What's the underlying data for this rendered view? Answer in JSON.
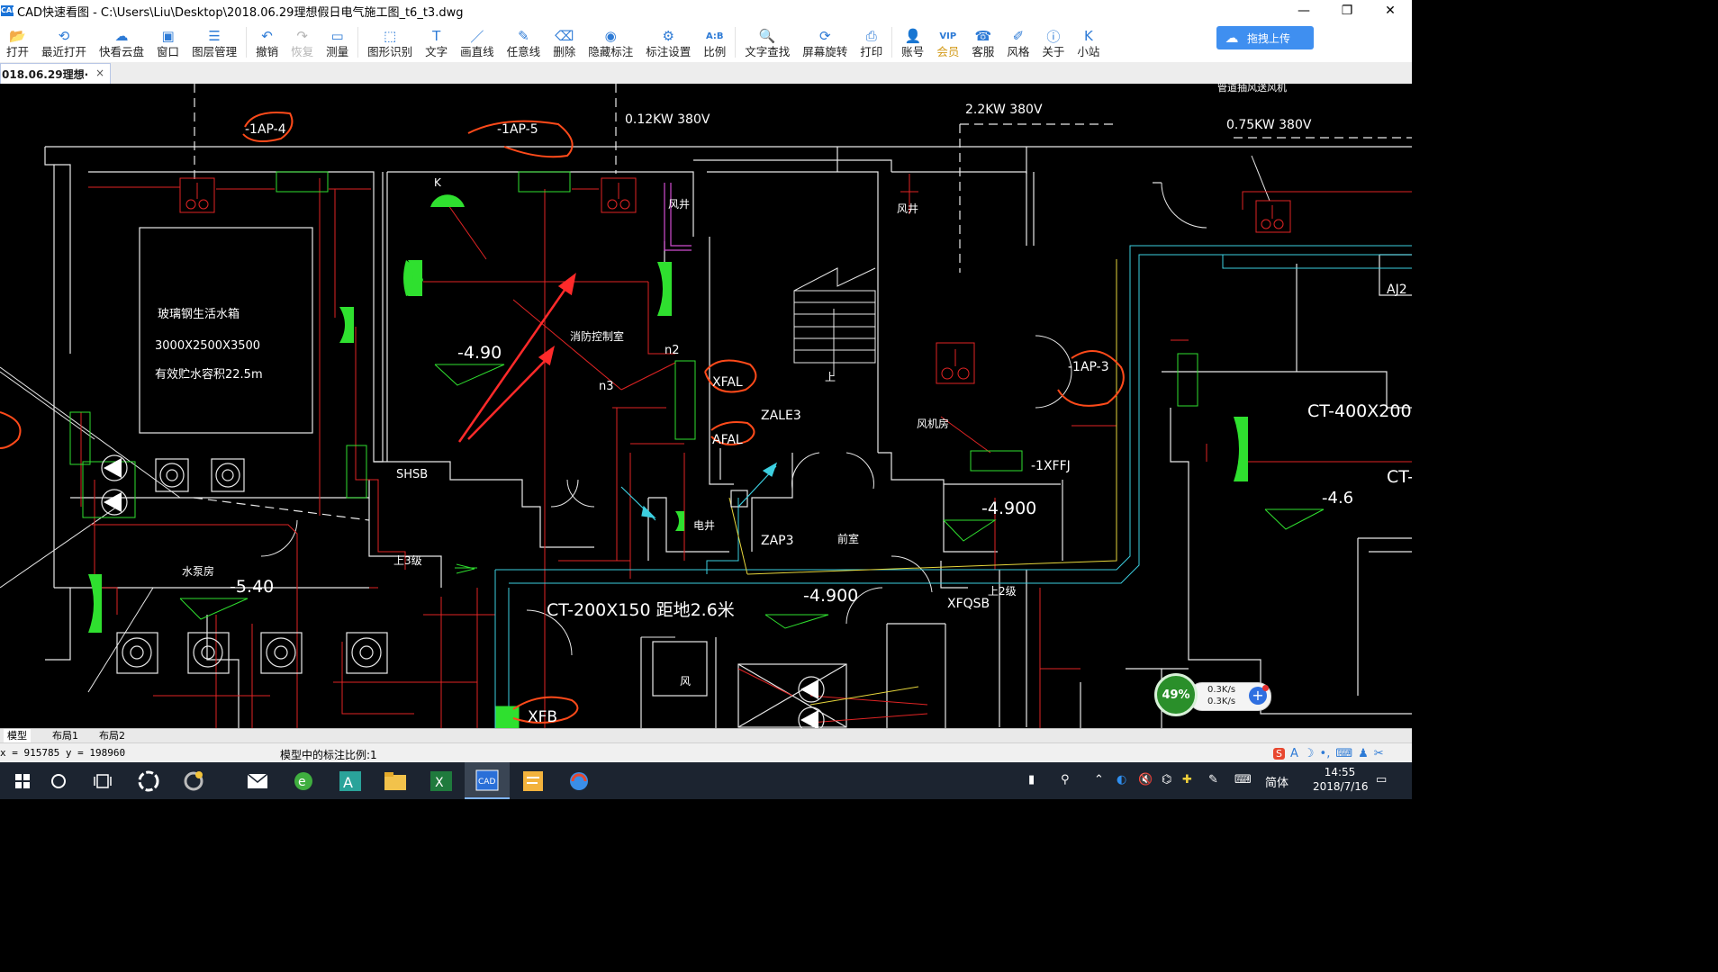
{
  "window": {
    "app_icon": "CAD",
    "title": "CAD快速看图 - C:\\Users\\Liu\\Desktop\\2018.06.29理想假日电气施工图_t6_t3.dwg",
    "minimize": "—",
    "restore": "❐",
    "close": "✕"
  },
  "toolbar": [
    {
      "key": "open",
      "label": "打开",
      "icon": "folder-icon",
      "glyph": "📂"
    },
    {
      "key": "recent",
      "label": "最近打开",
      "icon": "clock-icon",
      "glyph": "⟲"
    },
    {
      "key": "cloud",
      "label": "快看云盘",
      "icon": "cloud-icon",
      "glyph": "☁"
    },
    {
      "key": "window",
      "label": "窗口",
      "icon": "window-icon",
      "glyph": "▣"
    },
    {
      "key": "layers",
      "label": "图层管理",
      "icon": "layers-icon",
      "glyph": "☰"
    },
    {
      "key": "undo",
      "label": "撤销",
      "icon": "undo-icon",
      "glyph": "↶"
    },
    {
      "key": "redo",
      "label": "恢复",
      "icon": "redo-icon",
      "glyph": "↷",
      "disabled": true
    },
    {
      "key": "measure",
      "label": "测量",
      "icon": "ruler-icon",
      "glyph": "▭"
    },
    {
      "key": "shape",
      "label": "图形识别",
      "icon": "shape-recognize-icon",
      "glyph": "⬚"
    },
    {
      "key": "text",
      "label": "文字",
      "icon": "text-icon",
      "glyph": "T"
    },
    {
      "key": "line",
      "label": "画直线",
      "icon": "line-icon",
      "glyph": "／"
    },
    {
      "key": "freeline",
      "label": "任意线",
      "icon": "pen-icon",
      "glyph": "✎"
    },
    {
      "key": "delete",
      "label": "删除",
      "icon": "eraser-icon",
      "glyph": "⌫"
    },
    {
      "key": "hide",
      "label": "隐藏标注",
      "icon": "eye-hide-icon",
      "glyph": "◉"
    },
    {
      "key": "markset",
      "label": "标注设置",
      "icon": "mark-settings-icon",
      "glyph": "⚙"
    },
    {
      "key": "ratio",
      "label": "比例",
      "icon": "ratio-icon",
      "glyph": "A:B"
    },
    {
      "key": "search",
      "label": "文字查找",
      "icon": "text-search-icon",
      "glyph": "🔍"
    },
    {
      "key": "rotate",
      "label": "屏幕旋转",
      "icon": "rotate-icon",
      "glyph": "⟳"
    },
    {
      "key": "print",
      "label": "打印",
      "icon": "printer-icon",
      "glyph": "⎙"
    },
    {
      "key": "account",
      "label": "账号",
      "icon": "user-icon",
      "glyph": "👤"
    },
    {
      "key": "vip",
      "label": "会员",
      "icon": "vip-icon",
      "glyph": "VIP"
    },
    {
      "key": "service",
      "label": "客服",
      "icon": "headset-icon",
      "glyph": "☎"
    },
    {
      "key": "style",
      "label": "风格",
      "icon": "style-icon",
      "glyph": "✐"
    },
    {
      "key": "about",
      "label": "关于",
      "icon": "info-icon",
      "glyph": "ⓘ"
    },
    {
      "key": "station",
      "label": "小站",
      "icon": "k-icon",
      "glyph": "K"
    }
  ],
  "upload_button": "拖拽上传",
  "file_tab": {
    "label": "018.06.29理想·",
    "close": "×"
  },
  "model_tabs": [
    "模型",
    "布局1",
    "布局2"
  ],
  "status": {
    "coords": "x = 915785  y = 198960",
    "scale": "模型中的标注比例:1"
  },
  "net_widget": {
    "percent": "49%",
    "up": "0.3K/s",
    "down": "0.3K/s",
    "plus": "+"
  },
  "tray": {
    "ime": "简体",
    "time": "14:55",
    "date": "2018/7/16"
  },
  "drawing": {
    "texts": [
      {
        "id": "lbl-1ap4",
        "text": "-1AP-4",
        "color": "#ffffff"
      },
      {
        "id": "lbl-1ap5",
        "text": "-1AP-5",
        "color": "#ffffff"
      },
      {
        "id": "lbl-012kw",
        "text": "0.12KW  380V",
        "color": "#ffffff"
      },
      {
        "id": "lbl-22kw",
        "text": "2.2KW  380V",
        "color": "#ffffff"
      },
      {
        "id": "lbl-075kw",
        "text": "0.75KW  380V",
        "color": "#ffffff"
      },
      {
        "id": "lbl-fan-top",
        "text": "管道抽风送风机",
        "color": "#ffffff"
      },
      {
        "id": "lbl-k",
        "text": "K",
        "color": "#ffffff"
      },
      {
        "id": "lbl-windwell1",
        "text": "风井",
        "color": "#ffffff"
      },
      {
        "id": "lbl-windwell2",
        "text": "风井",
        "color": "#ffffff"
      },
      {
        "id": "lbl-aj2",
        "text": "AJ2",
        "color": "#ffffff"
      },
      {
        "id": "lbl-tank",
        "text": "玻璃钢生活水箱",
        "color": "#ffffff"
      },
      {
        "id": "lbl-tank-size",
        "text": "3000X2500X3500",
        "color": "#ffffff"
      },
      {
        "id": "lbl-tank-vol",
        "text": "有效贮水容积22.5m",
        "color": "#ffffff"
      },
      {
        "id": "lbl-490",
        "text": "-4.90",
        "color": "#ffffff"
      },
      {
        "id": "lbl-control",
        "text": "消防控制室",
        "color": "#ffffff"
      },
      {
        "id": "lbl-n2",
        "text": "n2",
        "color": "#ffffff"
      },
      {
        "id": "lbl-n3",
        "text": "n3",
        "color": "#ffffff"
      },
      {
        "id": "lbl-xfal",
        "text": "XFAL",
        "color": "#ffffff"
      },
      {
        "id": "lbl-afal",
        "text": "AFAL",
        "color": "#ffffff"
      },
      {
        "id": "lbl-zale3",
        "text": "ZALE3",
        "color": "#ffffff"
      },
      {
        "id": "lbl-up",
        "text": "上",
        "color": "#ffffff"
      },
      {
        "id": "lbl-1ap3",
        "text": "-1AP-3",
        "color": "#ffffff"
      },
      {
        "id": "lbl-fanroom",
        "text": "风机房",
        "color": "#ffffff"
      },
      {
        "id": "lbl-ct400",
        "text": "CT-400X200",
        "color": "#ffffff"
      },
      {
        "id": "lbl-ct-right",
        "text": "CT-",
        "color": "#ffffff"
      },
      {
        "id": "lbl-46",
        "text": "-4.6",
        "color": "#ffffff"
      },
      {
        "id": "lbl-1xffj",
        "text": "-1XFFJ",
        "color": "#ffffff"
      },
      {
        "id": "lbl-4900a",
        "text": "-4.900",
        "color": "#ffffff"
      },
      {
        "id": "lbl-shsb",
        "text": "SHSB",
        "color": "#ffffff"
      },
      {
        "id": "lbl-elec-well",
        "text": "电井",
        "color": "#ffffff"
      },
      {
        "id": "lbl-zap3",
        "text": "ZAP3",
        "color": "#ffffff"
      },
      {
        "id": "lbl-lobby",
        "text": "前室",
        "color": "#ffffff"
      },
      {
        "id": "lbl-up3",
        "text": "上3级",
        "color": "#ffffff"
      },
      {
        "id": "lbl-pump",
        "text": "水泵房",
        "color": "#ffffff"
      },
      {
        "id": "lbl-540",
        "text": "-5.40",
        "color": "#ffffff"
      },
      {
        "id": "lbl-ct200",
        "text": "CT-200X150  距地2.6米",
        "color": "#ffffff"
      },
      {
        "id": "lbl-4900b",
        "text": "-4.900",
        "color": "#ffffff"
      },
      {
        "id": "lbl-up2",
        "text": "上2级",
        "color": "#ffffff"
      },
      {
        "id": "lbl-xfqsb",
        "text": "XFQSB",
        "color": "#ffffff"
      },
      {
        "id": "lbl-wind",
        "text": "风",
        "color": "#ffffff"
      },
      {
        "id": "lbl-xfb",
        "text": "XFB",
        "color": "#ffffff"
      }
    ]
  }
}
